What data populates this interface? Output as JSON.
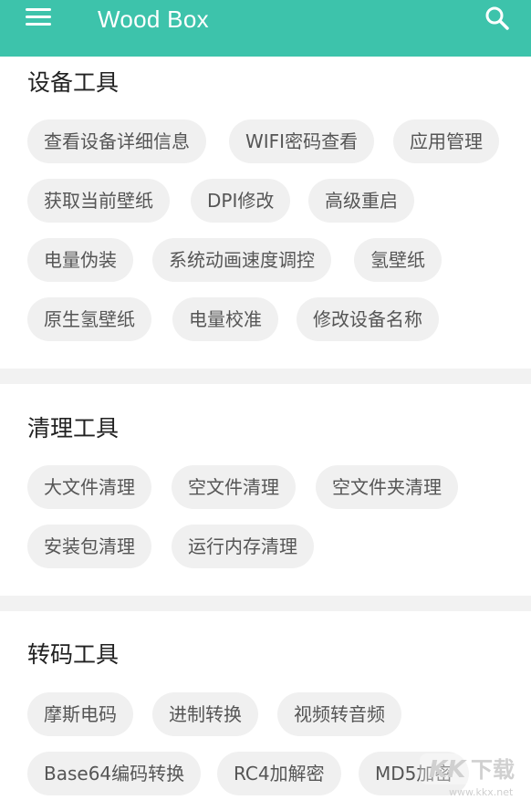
{
  "app": {
    "title": "Wood Box",
    "menu_icon": "hamburger-menu-icon",
    "search_icon": "search-icon"
  },
  "sections": [
    {
      "title": "设备工具",
      "rows": [
        [
          "查看设备详细信息",
          "WIFI密码查看",
          "应用管理"
        ],
        [
          "获取当前壁纸",
          "DPI修改",
          "高级重启"
        ],
        [
          "电量伪装",
          "系统动画速度调控",
          "氢壁纸"
        ],
        [
          "原生氢壁纸",
          "电量校准",
          "修改设备名称"
        ]
      ]
    },
    {
      "title": "清理工具",
      "rows": [
        [
          "大文件清理",
          "空文件清理",
          "空文件夹清理"
        ],
        [
          "安装包清理",
          "运行内存清理"
        ]
      ]
    },
    {
      "title": "转码工具",
      "rows": [
        [
          "摩斯电码",
          "进制转换",
          "视频转音频"
        ],
        [
          "Base64编码转换",
          "RC4加解密",
          "MD5加密"
        ]
      ]
    }
  ],
  "watermark": {
    "brand": "KK下载",
    "url": "www.kkx.net"
  },
  "colors": {
    "accent": "#3dc3ab",
    "chip_bg": "#f0f0f0",
    "chip_text": "#555555",
    "title_text": "#212121"
  }
}
